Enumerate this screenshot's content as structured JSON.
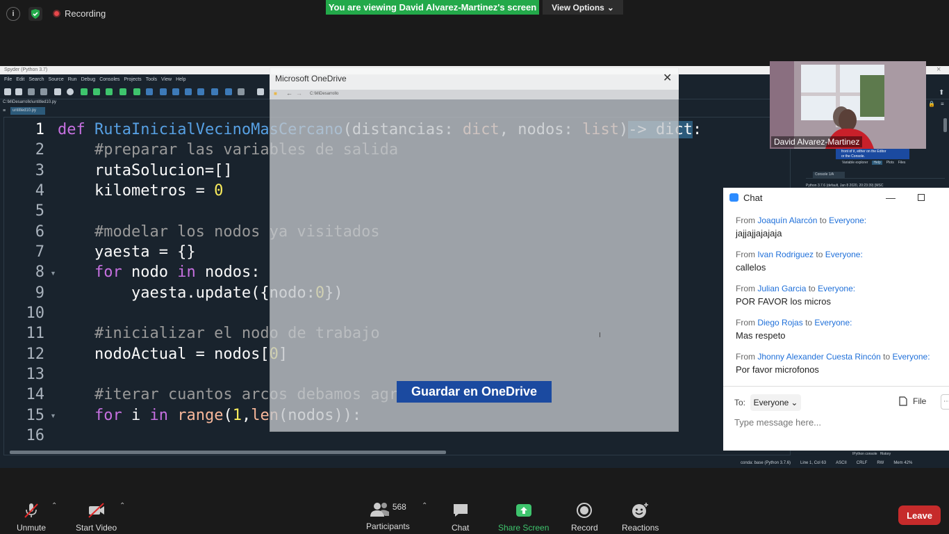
{
  "zoom": {
    "recording_label": "Recording",
    "viewing_banner": "You are viewing David Alvarez-Martinez's screen",
    "view_options": "View Options",
    "participant_name": "David Alvarez-Martinez",
    "toolbar": {
      "unmute": "Unmute",
      "start_video": "Start Video",
      "participants": "Participants",
      "participants_count": "568",
      "chat": "Chat",
      "share_screen": "Share Screen",
      "record": "Record",
      "reactions": "Reactions",
      "leave": "Leave"
    },
    "colors": {
      "banner": "#23a94a",
      "leave": "#c62b2b",
      "share": "#3ec46d"
    }
  },
  "spyder": {
    "title": "Spyder (Python 3.7)",
    "menu": [
      "File",
      "Edit",
      "Search",
      "Source",
      "Run",
      "Debug",
      "Consoles",
      "Projects",
      "Tools",
      "View",
      "Help"
    ],
    "path": "C:\\MiDesarrollo\\untitled10.py",
    "tab": "untitled10.py",
    "line_numbers": [
      "1",
      "2",
      "3",
      "4",
      "5",
      "6",
      "7",
      "8",
      "9",
      "10",
      "11",
      "12",
      "13",
      "14",
      "15",
      "16"
    ],
    "status": [
      "conda: base (Python 3.7.6)",
      "Line 1, Col 63",
      "ASCII",
      "CRLF",
      "RW",
      "Mem 42%"
    ],
    "right_pane": {
      "hint_line1": "front of it, either on the Editor",
      "hint_line2": "or the Console.",
      "tabs": [
        "Variable explorer",
        "Help",
        "Plots",
        "Files"
      ],
      "console_tab": "Console 1/A",
      "console_text": "Python 3.7.6 (default, Jan  8 2020, 20:23:39) [MSC",
      "bottom_tabs": [
        "IPython console",
        "History"
      ]
    }
  },
  "onedrive": {
    "title": "Microsoft OneDrive",
    "path": "C:\\MiDesarrollo",
    "save_button": "Guardar en OneDrive"
  },
  "chat": {
    "title": "Chat",
    "messages": [
      {
        "from": "Joaquín Alarcón",
        "to": "Everyone:",
        "text": "jajjajjajajaja"
      },
      {
        "from": "Ivan Rodriguez",
        "to": "Everyone:",
        "text": "callelos"
      },
      {
        "from": "Julian Garcia",
        "to": "Everyone:",
        "text": "POR FAVOR los micros"
      },
      {
        "from": "Diego Rojas",
        "to": "Everyone:",
        "text": "Mas respeto"
      },
      {
        "from": "Jhonny Alexander Cuesta Rincón",
        "to": "Everyone:",
        "text": "Por favor microfonos"
      }
    ],
    "from_word": "From",
    "to_word": "to",
    "to_label": "To:",
    "recipient": "Everyone",
    "file_label": "File",
    "input_placeholder": "Type message here..."
  }
}
